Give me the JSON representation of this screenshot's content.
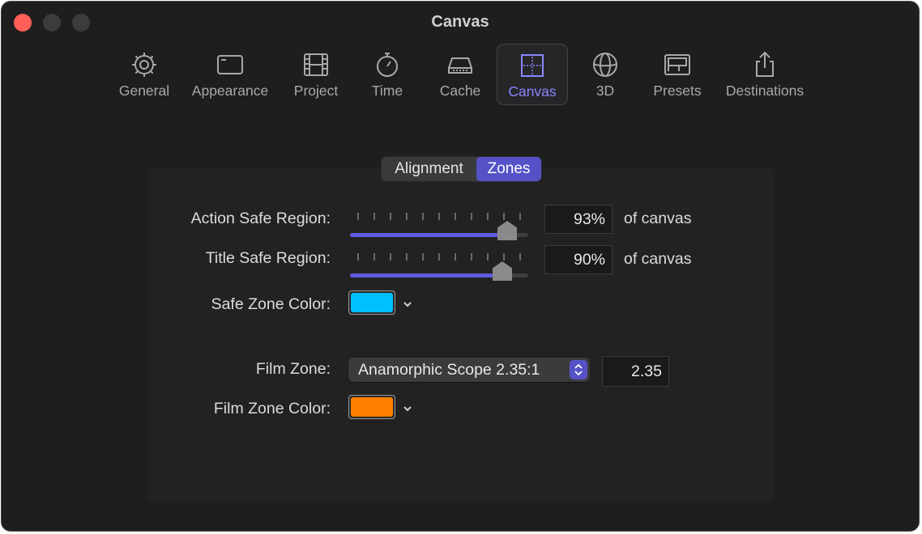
{
  "window": {
    "title": "Canvas"
  },
  "toolbar": {
    "items": [
      {
        "label": "General",
        "icon": "gear-icon"
      },
      {
        "label": "Appearance",
        "icon": "window-icon"
      },
      {
        "label": "Project",
        "icon": "film-icon"
      },
      {
        "label": "Time",
        "icon": "stopwatch-icon"
      },
      {
        "label": "Cache",
        "icon": "drive-icon"
      },
      {
        "label": "Canvas",
        "icon": "canvas-icon",
        "active": true
      },
      {
        "label": "3D",
        "icon": "globe-icon"
      },
      {
        "label": "Presets",
        "icon": "presets-icon"
      },
      {
        "label": "Destinations",
        "icon": "share-icon"
      }
    ]
  },
  "tabs": {
    "alignment": "Alignment",
    "zones": "Zones",
    "selected": "Zones"
  },
  "zones": {
    "action_safe": {
      "label": "Action Safe Region:",
      "value": "93%",
      "fraction": 0.93,
      "suffix": "of canvas"
    },
    "title_safe": {
      "label": "Title Safe Region:",
      "value": "90%",
      "fraction": 0.9,
      "suffix": "of canvas"
    },
    "safe_zone_color": {
      "label": "Safe Zone Color:",
      "color": "#00bfff"
    },
    "film_zone": {
      "label": "Film Zone:",
      "selected": "Anamorphic Scope 2.35:1",
      "value": "2.35"
    },
    "film_zone_color": {
      "label": "Film Zone Color:",
      "color": "#ff8000"
    }
  },
  "colors": {
    "accent": "#5552c8",
    "active_icon": "#8a86ff",
    "slider_fill": "#5f5be0"
  }
}
